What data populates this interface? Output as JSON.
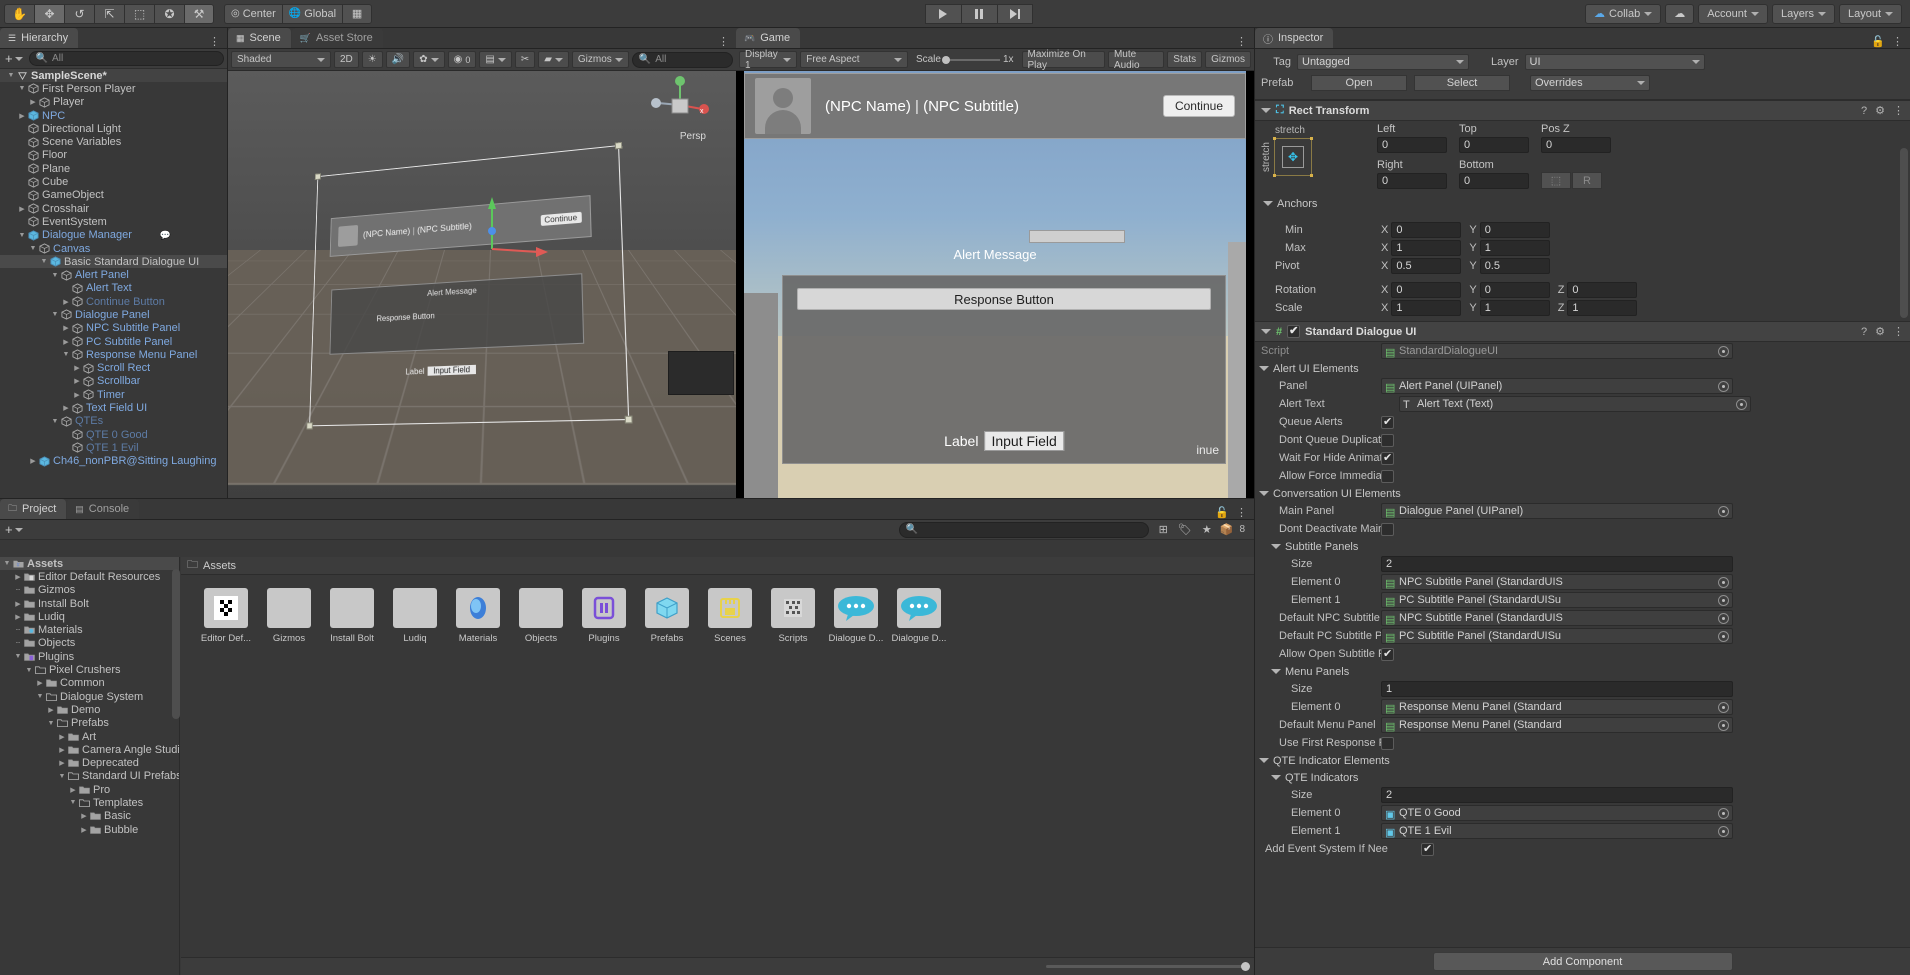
{
  "toolbar": {
    "tools": [
      {
        "name": "hand-tool",
        "glyph": "✋",
        "active": false
      },
      {
        "name": "move-tool",
        "glyph": "✥",
        "active": true
      },
      {
        "name": "rotate-tool",
        "glyph": "↺",
        "active": false
      },
      {
        "name": "scale-tool",
        "glyph": "⤢",
        "active": false
      },
      {
        "name": "rect-tool",
        "glyph": "⬚",
        "active": false
      },
      {
        "name": "transform-tool",
        "glyph": "✪",
        "active": false
      },
      {
        "name": "custom-tool",
        "glyph": "⚒",
        "active": false
      }
    ],
    "pivot_label": "Center",
    "space_label": "Global",
    "grid_label": "",
    "collab_label": "Collab",
    "cloud_label": "",
    "account_label": "Account",
    "layers_label": "Layers",
    "layout_label": "Layout"
  },
  "hierarchy": {
    "tab": "Hierarchy",
    "search_placeholder": "All",
    "items": [
      {
        "label": "SampleScene*",
        "depth": 0,
        "arrow": "down",
        "icon": "scene",
        "style": "scene"
      },
      {
        "label": "First Person Player",
        "depth": 1,
        "arrow": "down",
        "icon": "cube",
        "style": ""
      },
      {
        "label": "Player",
        "depth": 2,
        "arrow": "right",
        "icon": "cube",
        "style": ""
      },
      {
        "label": "NPC",
        "depth": 1,
        "arrow": "right",
        "icon": "prefab",
        "style": "blue"
      },
      {
        "label": "Directional Light",
        "depth": 1,
        "arrow": "",
        "icon": "cube",
        "style": ""
      },
      {
        "label": "Scene Variables",
        "depth": 1,
        "arrow": "",
        "icon": "cube",
        "style": ""
      },
      {
        "label": "Floor",
        "depth": 1,
        "arrow": "",
        "icon": "cube",
        "style": ""
      },
      {
        "label": "Plane",
        "depth": 1,
        "arrow": "",
        "icon": "cube",
        "style": ""
      },
      {
        "label": "Cube",
        "depth": 1,
        "arrow": "",
        "icon": "cube",
        "style": ""
      },
      {
        "label": "GameObject",
        "depth": 1,
        "arrow": "",
        "icon": "cube",
        "style": ""
      },
      {
        "label": "Crosshair",
        "depth": 1,
        "arrow": "right",
        "icon": "cube",
        "style": ""
      },
      {
        "label": "EventSystem",
        "depth": 1,
        "arrow": "",
        "icon": "cube",
        "style": ""
      },
      {
        "label": "Dialogue Manager",
        "depth": 1,
        "arrow": "down",
        "icon": "prefab",
        "style": "blue",
        "badge": "dialogue"
      },
      {
        "label": "Canvas",
        "depth": 2,
        "arrow": "down",
        "icon": "cube",
        "style": "blue"
      },
      {
        "label": "Basic Standard Dialogue UI",
        "depth": 3,
        "arrow": "down",
        "icon": "prefab-variant",
        "style": "selected",
        "selected": true
      },
      {
        "label": "Alert Panel",
        "depth": 4,
        "arrow": "down",
        "icon": "cube",
        "style": "blue"
      },
      {
        "label": "Alert Text",
        "depth": 5,
        "arrow": "",
        "icon": "cube",
        "style": "blue"
      },
      {
        "label": "Continue Button",
        "depth": 5,
        "arrow": "right",
        "icon": "cube",
        "style": "dimblue"
      },
      {
        "label": "Dialogue Panel",
        "depth": 4,
        "arrow": "down",
        "icon": "cube",
        "style": "blue"
      },
      {
        "label": "NPC Subtitle Panel",
        "depth": 5,
        "arrow": "right",
        "icon": "cube",
        "style": "blue"
      },
      {
        "label": "PC Subtitle Panel",
        "depth": 5,
        "arrow": "right",
        "icon": "cube",
        "style": "blue"
      },
      {
        "label": "Response Menu Panel",
        "depth": 5,
        "arrow": "down",
        "icon": "cube",
        "style": "blue"
      },
      {
        "label": "Scroll Rect",
        "depth": 6,
        "arrow": "right",
        "icon": "cube",
        "style": "blue"
      },
      {
        "label": "Scrollbar",
        "depth": 6,
        "arrow": "right",
        "icon": "cube",
        "style": "blue"
      },
      {
        "label": "Timer",
        "depth": 6,
        "arrow": "right",
        "icon": "cube",
        "style": "blue"
      },
      {
        "label": "Text Field UI",
        "depth": 5,
        "arrow": "right",
        "icon": "cube",
        "style": "blue"
      },
      {
        "label": "QTEs",
        "depth": 4,
        "arrow": "down",
        "icon": "cube",
        "style": "dimblue"
      },
      {
        "label": "QTE 0 Good",
        "depth": 5,
        "arrow": "",
        "icon": "cube",
        "style": "dimblue"
      },
      {
        "label": "QTE 1 Evil",
        "depth": 5,
        "arrow": "",
        "icon": "cube",
        "style": "dimblue"
      },
      {
        "label": "Ch46_nonPBR@Sitting Laughing",
        "depth": 2,
        "arrow": "right",
        "icon": "prefab",
        "style": "blue"
      }
    ]
  },
  "scene_view": {
    "tabs": [
      {
        "label": "Scene",
        "active": true
      },
      {
        "label": "Asset Store",
        "active": false
      }
    ],
    "shading": "Shaded",
    "mode_2d": "2D",
    "gizmos": "Gizmos",
    "search_placeholder": "All",
    "persp_label": "Persp",
    "overlay": {
      "npc_name": "(NPC Name)",
      "npc_subtitle": "(NPC Subtitle)",
      "continue": "Continue",
      "alert_message": "Alert Message",
      "response_button": "Response Button",
      "label": "Label",
      "input_field": "Input Field"
    }
  },
  "game_view": {
    "tab": "Game",
    "display": "Display 1",
    "aspect": "Free Aspect",
    "scale_label": "Scale",
    "scale_value": "1x",
    "maximize": "Maximize On Play",
    "mute": "Mute Audio",
    "stats": "Stats",
    "gizmos": "Gizmos",
    "content": {
      "npc_name": "(NPC Name)",
      "npc_subtitle": "(NPC Subtitle)",
      "continue": "Continue",
      "alert_message": "Alert Message",
      "response_button": "Response Button",
      "label": "Label",
      "input_field": "Input Field",
      "continue2": "inue"
    }
  },
  "inspector": {
    "tab": "Inspector",
    "tag_label": "Tag",
    "tag_value": "Untagged",
    "layer_label": "Layer",
    "layer_value": "UI",
    "prefab_label": "Prefab",
    "open_btn": "Open",
    "select_btn": "Select",
    "overrides_btn": "Overrides",
    "rect_transform": {
      "title": "Rect Transform",
      "stretch_h": "stretch",
      "stretch_v": "stretch",
      "left_label": "Left",
      "left": "0",
      "top_label": "Top",
      "top": "0",
      "posz_label": "Pos Z",
      "posz": "0",
      "right_label": "Right",
      "right": "0",
      "bottom_label": "Bottom",
      "bottom": "0",
      "blueprint_btn": "",
      "raw_btn": "R",
      "anchors_label": "Anchors",
      "min_label": "Min",
      "min_x": "0",
      "min_y": "0",
      "max_label": "Max",
      "max_x": "1",
      "max_y": "1",
      "pivot_label": "Pivot",
      "pivot_x": "0.5",
      "pivot_y": "0.5",
      "rotation_label": "Rotation",
      "rot_x": "0",
      "rot_y": "0",
      "rot_z": "0",
      "scale_label": "Scale",
      "scale_x": "1",
      "scale_y": "1",
      "scale_z": "1"
    },
    "standard_dialogue_ui": {
      "title": "Standard Dialogue UI",
      "enabled": true,
      "script_label": "Script",
      "script_value": "StandardDialogueUI",
      "alert_section": "Alert UI Elements",
      "panel_label": "Panel",
      "panel_value": "Alert Panel (UIPanel)",
      "alert_text_label": "Alert Text",
      "alert_text_value": "Alert Text (Text)",
      "queue_alerts_label": "Queue Alerts",
      "queue_alerts": true,
      "dont_queue_label": "Dont Queue Duplicate",
      "dont_queue": false,
      "wait_hide_label": "Wait For Hide Animati",
      "wait_hide": true,
      "allow_force_label": "Allow Force Immediat",
      "allow_force": false,
      "conversation_section": "Conversation UI Elements",
      "main_panel_label": "Main Panel",
      "main_panel_value": "Dialogue Panel (UIPanel)",
      "dont_deactivate_label": "Dont Deactivate Main",
      "dont_deactivate": false,
      "subtitle_panels_label": "Subtitle Panels",
      "subtitle_size_label": "Size",
      "subtitle_size": "2",
      "subtitle_el0_label": "Element 0",
      "subtitle_el0": "NPC Subtitle Panel (StandardUIS",
      "subtitle_el1_label": "Element 1",
      "subtitle_el1": "PC Subtitle Panel (StandardUISu",
      "default_npc_label": "Default NPC Subtitle",
      "default_npc": "NPC Subtitle Panel (StandardUIS",
      "default_pc_label": "Default PC Subtitle P",
      "default_pc": "PC Subtitle Panel (StandardUISu",
      "allow_open_label": "Allow Open Subtitle P",
      "allow_open": true,
      "menu_panels_label": "Menu Panels",
      "menu_size_label": "Size",
      "menu_size": "1",
      "menu_el0_label": "Element 0",
      "menu_el0": "Response Menu Panel (Standard",
      "default_menu_label": "Default Menu Panel",
      "default_menu": "Response Menu Panel (Standard",
      "use_first_label": "Use First Response F",
      "use_first": false,
      "qte_section": "QTE Indicator Elements",
      "qte_indicators_label": "QTE Indicators",
      "qte_size_label": "Size",
      "qte_size": "2",
      "qte_el0_label": "Element 0",
      "qte_el0": "QTE 0 Good",
      "qte_el1_label": "Element 1",
      "qte_el1": "QTE 1 Evil",
      "add_event_label": "Add Event System If Nee",
      "add_event": true
    },
    "add_component": "Add Component"
  },
  "project": {
    "tabs": [
      {
        "label": "Project",
        "active": true
      },
      {
        "label": "Console",
        "active": false
      }
    ],
    "search_placeholder": "",
    "badge_count": "8",
    "assets_header": "Assets",
    "tree": [
      {
        "label": "Assets",
        "depth": 0,
        "arrow": "down",
        "icon": "assets",
        "selected": true
      },
      {
        "label": "Editor Default Resources",
        "depth": 1,
        "arrow": "right",
        "icon": "folder-special"
      },
      {
        "label": "Gizmos",
        "depth": 1,
        "arrow": "leaf",
        "icon": "folder"
      },
      {
        "label": "Install Bolt",
        "depth": 1,
        "arrow": "right",
        "icon": "folder"
      },
      {
        "label": "Ludiq",
        "depth": 1,
        "arrow": "right",
        "icon": "folder"
      },
      {
        "label": "Materials",
        "depth": 1,
        "arrow": "leaf",
        "icon": "folder-mat"
      },
      {
        "label": "Objects",
        "depth": 1,
        "arrow": "leaf",
        "icon": "folder"
      },
      {
        "label": "Plugins",
        "depth": 1,
        "arrow": "down",
        "icon": "folder-plug"
      },
      {
        "label": "Pixel Crushers",
        "depth": 2,
        "arrow": "down",
        "icon": "folder-open"
      },
      {
        "label": "Common",
        "depth": 3,
        "arrow": "right",
        "icon": "folder"
      },
      {
        "label": "Dialogue System",
        "depth": 3,
        "arrow": "down",
        "icon": "folder-open"
      },
      {
        "label": "Demo",
        "depth": 4,
        "arrow": "right",
        "icon": "folder"
      },
      {
        "label": "Prefabs",
        "depth": 4,
        "arrow": "down",
        "icon": "folder-open"
      },
      {
        "label": "Art",
        "depth": 5,
        "arrow": "right",
        "icon": "folder"
      },
      {
        "label": "Camera Angle Studio",
        "depth": 5,
        "arrow": "right",
        "icon": "folder"
      },
      {
        "label": "Deprecated",
        "depth": 5,
        "arrow": "right",
        "icon": "folder"
      },
      {
        "label": "Standard UI Prefabs",
        "depth": 5,
        "arrow": "down",
        "icon": "folder-open"
      },
      {
        "label": "Pro",
        "depth": 6,
        "arrow": "right",
        "icon": "folder"
      },
      {
        "label": "Templates",
        "depth": 6,
        "arrow": "down",
        "icon": "folder-open"
      },
      {
        "label": "Basic",
        "depth": 7,
        "arrow": "right",
        "icon": "folder"
      },
      {
        "label": "Bubble",
        "depth": 7,
        "arrow": "right",
        "icon": "folder"
      }
    ],
    "grid": [
      {
        "label": "Editor Def...",
        "icon": "editor"
      },
      {
        "label": "Gizmos",
        "icon": "folder"
      },
      {
        "label": "Install Bolt",
        "icon": "folder"
      },
      {
        "label": "Ludiq",
        "icon": "folder"
      },
      {
        "label": "Materials",
        "icon": "material"
      },
      {
        "label": "Objects",
        "icon": "folder"
      },
      {
        "label": "Plugins",
        "icon": "plugin"
      },
      {
        "label": "Prefabs",
        "icon": "prefab"
      },
      {
        "label": "Scenes",
        "icon": "scene"
      },
      {
        "label": "Scripts",
        "icon": "script"
      },
      {
        "label": "Dialogue D...",
        "icon": "dialogue"
      },
      {
        "label": "Dialogue D...",
        "icon": "dialogue"
      }
    ]
  },
  "colors": {
    "accent_blue": "#7fa9e0",
    "panel_bg": "#383838",
    "header_bg": "#3c3c3c",
    "selected": "#4a4a4a"
  }
}
